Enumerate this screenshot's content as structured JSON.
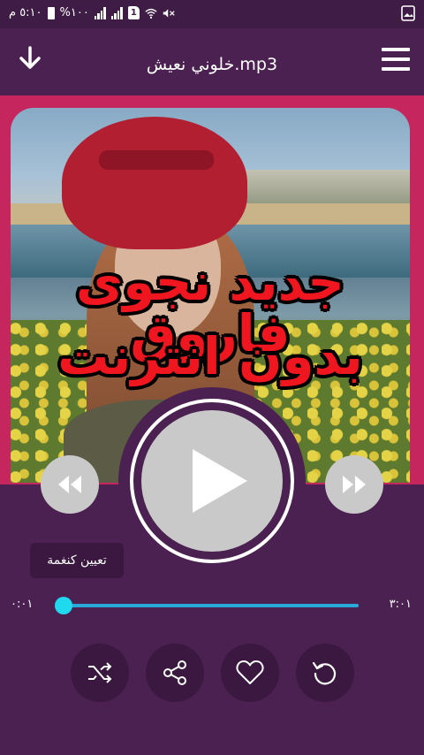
{
  "status_bar": {
    "time": "٥:١٠ م",
    "battery": "%١٠٠"
  },
  "header": {
    "title": "خلوني نعيش.mp3"
  },
  "artwork": {
    "line1": "جديد نجوى فاروق",
    "line2": "بدون انترنت"
  },
  "player": {
    "set_ringtone_label": "تعيين كنغمة",
    "current_time": "٠:٠١",
    "total_time": "٣:٠١",
    "progress": 0.0
  },
  "colors": {
    "background": "#4a2150",
    "accent": "#2aa9d9",
    "thumb": "#1fd9ef",
    "frame": "#c4265d",
    "art_text": "#ef1620"
  },
  "icons": [
    "download-icon",
    "menu-icon",
    "play-icon",
    "rewind-icon",
    "fast-forward-icon",
    "shuffle-icon",
    "share-icon",
    "heart-icon",
    "repeat-icon"
  ]
}
